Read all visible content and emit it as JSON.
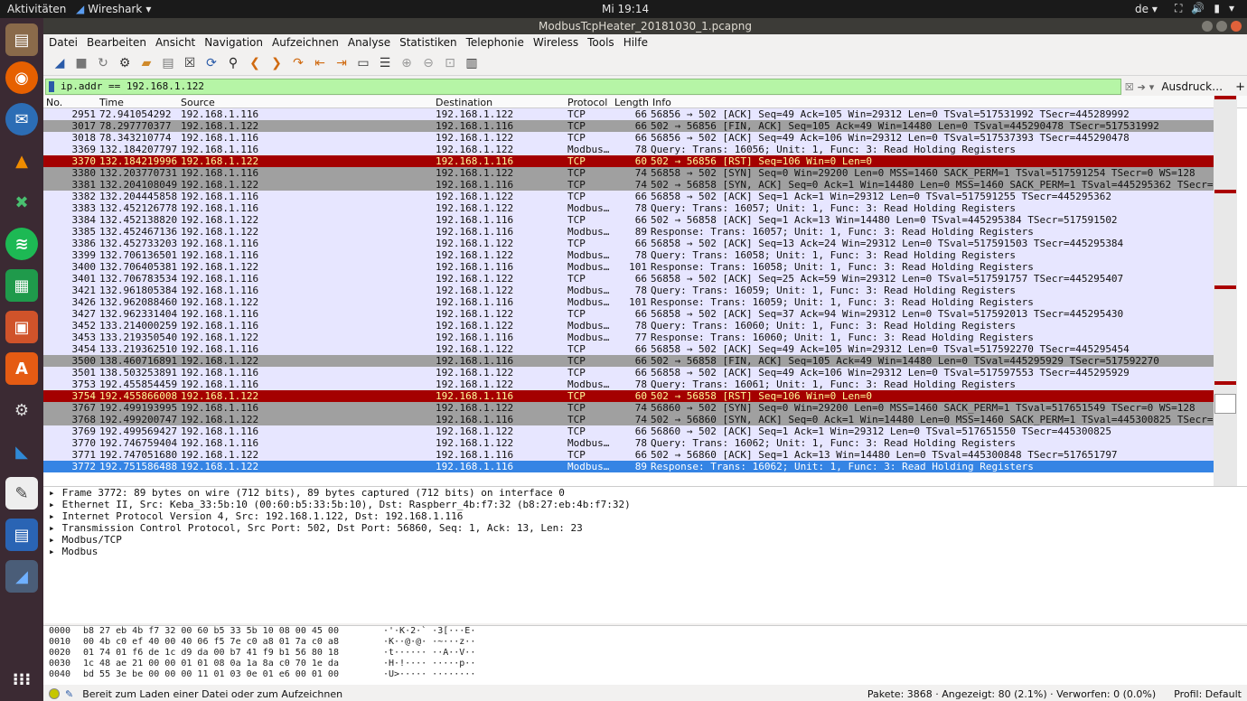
{
  "topbar": {
    "activities": "Aktivitäten",
    "app": "Wireshark",
    "clock": "Mi 19:14",
    "lang": "de"
  },
  "window": {
    "title": "ModbusTcpHeater_20181030_1.pcapng"
  },
  "menu": [
    "Datei",
    "Bearbeiten",
    "Ansicht",
    "Navigation",
    "Aufzeichnen",
    "Analyse",
    "Statistiken",
    "Telephonie",
    "Wireless",
    "Tools",
    "Hilfe"
  ],
  "filter": {
    "value": "ip.addr == 192.168.1.122",
    "expr_label": "Ausdruck…",
    "plus": "+"
  },
  "columns": {
    "no": "No.",
    "time": "Time",
    "source": "Source",
    "destination": "Destination",
    "protocol": "Protocol",
    "length": "Length",
    "info": "Info"
  },
  "packets": [
    {
      "no": "2951",
      "time": "72.941054292",
      "src": "192.168.1.116",
      "dst": "192.168.1.122",
      "proto": "TCP",
      "len": "66",
      "info": "56856 → 502 [ACK] Seq=49 Ack=105 Win=29312 Len=0 TSval=517531992 TSecr=445289992",
      "style": "tcp"
    },
    {
      "no": "3017",
      "time": "78.297770377",
      "src": "192.168.1.122",
      "dst": "192.168.1.116",
      "proto": "TCP",
      "len": "66",
      "info": "502 → 56856 [FIN, ACK] Seq=105 Ack=49 Win=14480 Len=0 TSval=445290478 TSecr=517531992",
      "style": "syn"
    },
    {
      "no": "3018",
      "time": "78.343210774",
      "src": "192.168.1.116",
      "dst": "192.168.1.122",
      "proto": "TCP",
      "len": "66",
      "info": "56856 → 502 [ACK] Seq=49 Ack=106 Win=29312 Len=0 TSval=517537393 TSecr=445290478",
      "style": "tcp"
    },
    {
      "no": "3369",
      "time": "132.184207797",
      "src": "192.168.1.116",
      "dst": "192.168.1.122",
      "proto": "Modbus…",
      "len": "78",
      "info": "  Query: Trans: 16056; Unit:   1, Func:   3: Read Holding Registers",
      "style": "mod"
    },
    {
      "no": "3370",
      "time": "132.184219996",
      "src": "192.168.1.122",
      "dst": "192.168.1.116",
      "proto": "TCP",
      "len": "60",
      "info": "502 → 56856 [RST] Seq=106 Win=0 Len=0",
      "style": "rst"
    },
    {
      "no": "3380",
      "time": "132.203770731",
      "src": "192.168.1.116",
      "dst": "192.168.1.122",
      "proto": "TCP",
      "len": "74",
      "info": "56858 → 502 [SYN] Seq=0 Win=29200 Len=0 MSS=1460 SACK_PERM=1 TSval=517591254 TSecr=0 WS=128",
      "style": "syn"
    },
    {
      "no": "3381",
      "time": "132.204108049",
      "src": "192.168.1.122",
      "dst": "192.168.1.116",
      "proto": "TCP",
      "len": "74",
      "info": "502 → 56858 [SYN, ACK] Seq=0 Ack=1 Win=14480 Len=0 MSS=1460 SACK_PERM=1 TSval=445295362 TSecr=517",
      "style": "syn"
    },
    {
      "no": "3382",
      "time": "132.204445858",
      "src": "192.168.1.116",
      "dst": "192.168.1.122",
      "proto": "TCP",
      "len": "66",
      "info": "56858 → 502 [ACK] Seq=1 Ack=1 Win=29312 Len=0 TSval=517591255 TSecr=445295362",
      "style": "tcp"
    },
    {
      "no": "3383",
      "time": "132.452126778",
      "src": "192.168.1.116",
      "dst": "192.168.1.122",
      "proto": "Modbus…",
      "len": "78",
      "info": "  Query: Trans: 16057; Unit:   1, Func:   3: Read Holding Registers",
      "style": "mod"
    },
    {
      "no": "3384",
      "time": "132.452138820",
      "src": "192.168.1.122",
      "dst": "192.168.1.116",
      "proto": "TCP",
      "len": "66",
      "info": "502 → 56858 [ACK] Seq=1 Ack=13 Win=14480 Len=0 TSval=445295384 TSecr=517591502",
      "style": "tcp"
    },
    {
      "no": "3385",
      "time": "132.452467136",
      "src": "192.168.1.122",
      "dst": "192.168.1.116",
      "proto": "Modbus…",
      "len": "89",
      "info": "Response: Trans: 16057; Unit:   1, Func:   3: Read Holding Registers",
      "style": "mod"
    },
    {
      "no": "3386",
      "time": "132.452733203",
      "src": "192.168.1.116",
      "dst": "192.168.1.122",
      "proto": "TCP",
      "len": "66",
      "info": "56858 → 502 [ACK] Seq=13 Ack=24 Win=29312 Len=0 TSval=517591503 TSecr=445295384",
      "style": "tcp"
    },
    {
      "no": "3399",
      "time": "132.706136501",
      "src": "192.168.1.116",
      "dst": "192.168.1.122",
      "proto": "Modbus…",
      "len": "78",
      "info": "  Query: Trans: 16058; Unit:   1, Func:   3: Read Holding Registers",
      "style": "mod"
    },
    {
      "no": "3400",
      "time": "132.706405381",
      "src": "192.168.1.122",
      "dst": "192.168.1.116",
      "proto": "Modbus…",
      "len": "101",
      "info": "Response: Trans: 16058; Unit:   1, Func:   3: Read Holding Registers",
      "style": "mod"
    },
    {
      "no": "3401",
      "time": "132.706783534",
      "src": "192.168.1.116",
      "dst": "192.168.1.122",
      "proto": "TCP",
      "len": "66",
      "info": "56858 → 502 [ACK] Seq=25 Ack=59 Win=29312 Len=0 TSval=517591757 TSecr=445295407",
      "style": "tcp"
    },
    {
      "no": "3421",
      "time": "132.961805384",
      "src": "192.168.1.116",
      "dst": "192.168.1.122",
      "proto": "Modbus…",
      "len": "78",
      "info": "  Query: Trans: 16059; Unit:   1, Func:   3: Read Holding Registers",
      "style": "mod"
    },
    {
      "no": "3426",
      "time": "132.962088460",
      "src": "192.168.1.122",
      "dst": "192.168.1.116",
      "proto": "Modbus…",
      "len": "101",
      "info": "Response: Trans: 16059; Unit:   1, Func:   3: Read Holding Registers",
      "style": "mod"
    },
    {
      "no": "3427",
      "time": "132.962331404",
      "src": "192.168.1.116",
      "dst": "192.168.1.122",
      "proto": "TCP",
      "len": "66",
      "info": "56858 → 502 [ACK] Seq=37 Ack=94 Win=29312 Len=0 TSval=517592013 TSecr=445295430",
      "style": "tcp"
    },
    {
      "no": "3452",
      "time": "133.214000259",
      "src": "192.168.1.116",
      "dst": "192.168.1.122",
      "proto": "Modbus…",
      "len": "78",
      "info": "  Query: Trans: 16060; Unit:   1, Func:   3: Read Holding Registers",
      "style": "mod"
    },
    {
      "no": "3453",
      "time": "133.219350540",
      "src": "192.168.1.122",
      "dst": "192.168.1.116",
      "proto": "Modbus…",
      "len": "77",
      "info": "Response: Trans: 16060; Unit:   1, Func:   3: Read Holding Registers",
      "style": "mod"
    },
    {
      "no": "3454",
      "time": "133.219362510",
      "src": "192.168.1.116",
      "dst": "192.168.1.122",
      "proto": "TCP",
      "len": "66",
      "info": "56858 → 502 [ACK] Seq=49 Ack=105 Win=29312 Len=0 TSval=517592270 TSecr=445295454",
      "style": "tcp"
    },
    {
      "no": "3500",
      "time": "138.460716891",
      "src": "192.168.1.122",
      "dst": "192.168.1.116",
      "proto": "TCP",
      "len": "66",
      "info": "502 → 56858 [FIN, ACK] Seq=105 Ack=49 Win=14480 Len=0 TSval=445295929 TSecr=517592270",
      "style": "syn"
    },
    {
      "no": "3501",
      "time": "138.503253891",
      "src": "192.168.1.116",
      "dst": "192.168.1.122",
      "proto": "TCP",
      "len": "66",
      "info": "56858 → 502 [ACK] Seq=49 Ack=106 Win=29312 Len=0 TSval=517597553 TSecr=445295929",
      "style": "tcp"
    },
    {
      "no": "3753",
      "time": "192.455854459",
      "src": "192.168.1.116",
      "dst": "192.168.1.122",
      "proto": "Modbus…",
      "len": "78",
      "info": "  Query: Trans: 16061; Unit:   1, Func:   3: Read Holding Registers",
      "style": "mod"
    },
    {
      "no": "3754",
      "time": "192.455866008",
      "src": "192.168.1.122",
      "dst": "192.168.1.116",
      "proto": "TCP",
      "len": "60",
      "info": "502 → 56858 [RST] Seq=106 Win=0 Len=0",
      "style": "rst"
    },
    {
      "no": "3767",
      "time": "192.499193995",
      "src": "192.168.1.116",
      "dst": "192.168.1.122",
      "proto": "TCP",
      "len": "74",
      "info": "56860 → 502 [SYN] Seq=0 Win=29200 Len=0 MSS=1460 SACK_PERM=1 TSval=517651549 TSecr=0 WS=128",
      "style": "syn"
    },
    {
      "no": "3768",
      "time": "192.499200747",
      "src": "192.168.1.122",
      "dst": "192.168.1.116",
      "proto": "TCP",
      "len": "74",
      "info": "502 → 56860 [SYN, ACK] Seq=0 Ack=1 Win=14480 Len=0 MSS=1460 SACK_PERM=1 TSval=445300825 TSecr=51",
      "style": "syn"
    },
    {
      "no": "3769",
      "time": "192.499569427",
      "src": "192.168.1.116",
      "dst": "192.168.1.122",
      "proto": "TCP",
      "len": "66",
      "info": "56860 → 502 [ACK] Seq=1 Ack=1 Win=29312 Len=0 TSval=517651550 TSecr=445300825",
      "style": "tcp"
    },
    {
      "no": "3770",
      "time": "192.746759404",
      "src": "192.168.1.116",
      "dst": "192.168.1.122",
      "proto": "Modbus…",
      "len": "78",
      "info": "  Query: Trans: 16062; Unit:   1, Func:   3: Read Holding Registers",
      "style": "mod"
    },
    {
      "no": "3771",
      "time": "192.747051680",
      "src": "192.168.1.122",
      "dst": "192.168.1.116",
      "proto": "TCP",
      "len": "66",
      "info": "502 → 56860 [ACK] Seq=1 Ack=13 Win=14480 Len=0 TSval=445300848 TSecr=517651797",
      "style": "tcp"
    },
    {
      "no": "3772",
      "time": "192.751586488",
      "src": "192.168.1.122",
      "dst": "192.168.1.116",
      "proto": "Modbus…",
      "len": "89",
      "info": "Response: Trans: 16062; Unit:   1, Func:   3: Read Holding Registers",
      "style": "sel"
    }
  ],
  "details": [
    "Frame 3772: 89 bytes on wire (712 bits), 89 bytes captured (712 bits) on interface 0",
    "Ethernet II, Src: Keba_33:5b:10 (00:60:b5:33:5b:10), Dst: Raspberr_4b:f7:32 (b8:27:eb:4b:f7:32)",
    "Internet Protocol Version 4, Src: 192.168.1.122, Dst: 192.168.1.116",
    "Transmission Control Protocol, Src Port: 502, Dst Port: 56860, Seq: 1, Ack: 13, Len: 23",
    "Modbus/TCP",
    "Modbus"
  ],
  "hex": [
    {
      "o": "0000",
      "b": "b8 27 eb 4b f7 32 00 60  b5 33 5b 10 08 00 45 00",
      "a": "·'·K·2·`  ·3[···E·"
    },
    {
      "o": "0010",
      "b": "00 4b c0 ef 40 00 40 06  f5 7e c0 a8 01 7a c0 a8",
      "a": "·K··@·@·  ·~···z··"
    },
    {
      "o": "0020",
      "b": "01 74 01 f6 de 1c d9 da  00 b7 41 f9 b1 56 80 18",
      "a": "·t······  ··A··V··"
    },
    {
      "o": "0030",
      "b": "1c 48 ae 21 00 00 01 01  08 0a 1a 8a c0 70 1e da",
      "a": "·H·!····  ·····p··"
    },
    {
      "o": "0040",
      "b": "bd 55 3e be 00 00 00 11  01 03 0e 01 e6 00 01 00",
      "a": "·U>·····  ········"
    }
  ],
  "status": {
    "message": "Bereit zum Laden einer Datei oder zum Aufzeichnen",
    "stats": "Pakete: 3868 · Angezeigt: 80 (2.1%) · Verworfen: 0 (0.0%)",
    "profile": "Profil: Default"
  }
}
